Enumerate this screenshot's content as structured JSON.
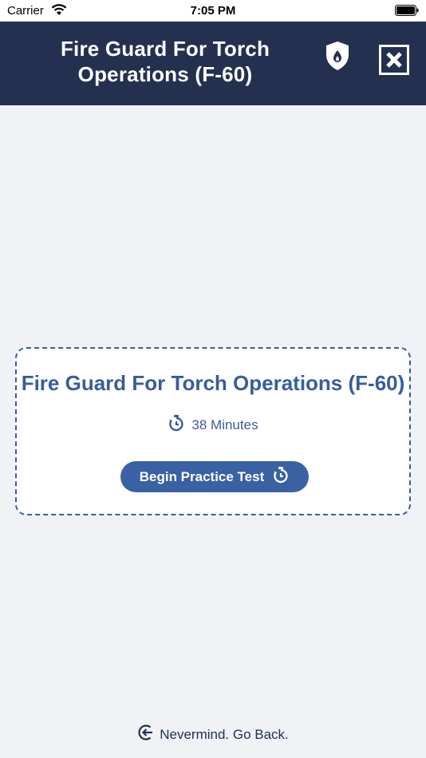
{
  "status_bar": {
    "carrier": "Carrier",
    "time": "7:05 PM",
    "wifi_icon": "wifi-icon",
    "battery_icon": "battery-full-icon"
  },
  "header": {
    "title": "Fire Guard For Torch Operations (F-60)",
    "background_color": "#24304f",
    "shield_icon": "shield-flame-icon",
    "close_icon": "close-box-icon"
  },
  "card": {
    "title": "Fire Guard For Torch Operations (F-60)",
    "duration": "38 Minutes",
    "timer_icon": "stopwatch-icon",
    "begin_button_label": "Begin Practice Test",
    "accent_color": "#3a5c9c"
  },
  "footer": {
    "back_label": "Nevermind. Go Back.",
    "back_icon": "arrow-left-circle-icon"
  }
}
